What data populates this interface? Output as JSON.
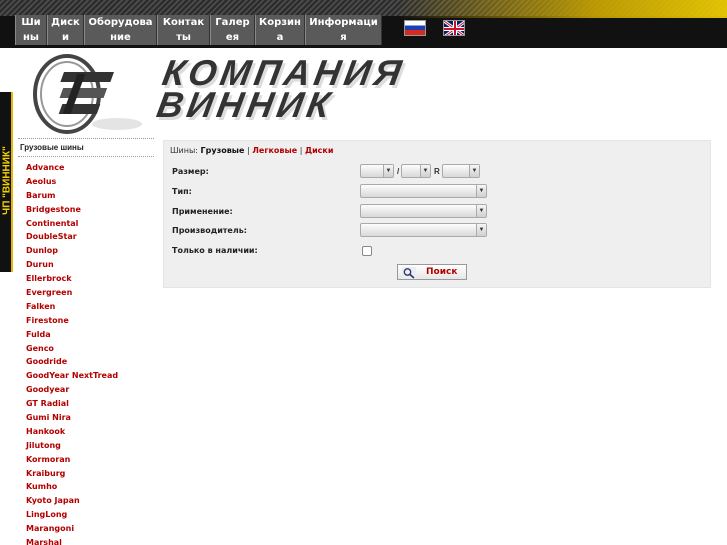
{
  "nav": {
    "items": [
      {
        "label": "Шины"
      },
      {
        "label": "Диски"
      },
      {
        "label": "Оборудование"
      },
      {
        "label": "Контакты"
      },
      {
        "label": "Галерея"
      },
      {
        "label": "Корзина"
      },
      {
        "label": "Информация"
      }
    ],
    "flags": [
      "flag-ru-icon",
      "flag-uk-icon"
    ]
  },
  "side_tab": {
    "label": "ЧП \"ВИННИК\""
  },
  "logo": {
    "line1": "КОМПАНИЯ",
    "line2": "ВИННИК"
  },
  "sidebar": {
    "title": "Грузовые шины",
    "brands": [
      "Advance",
      "Aeolus",
      "Barum",
      "Bridgestone",
      "Continental",
      "DoubleStar",
      "Dunlop",
      "Durun",
      "Ellerbrock",
      "Evergreen",
      "Falken",
      "Firestone",
      "Fulda",
      "Genco",
      "Goodride",
      "GoodYear NextTread",
      "Goodyear",
      "GT Radial",
      "Gumi Nira",
      "Hankook",
      "Jilutong",
      "Kormoran",
      "Kraiburg",
      "Kumho",
      "Kyoto Japan",
      "LingLong",
      "Marangoni",
      "Marshal"
    ]
  },
  "search": {
    "breadcrumb": {
      "prefix": "Шины:",
      "current": "Грузовые",
      "sep1": "|",
      "link1": "Легковые",
      "sep2": "|",
      "link2": "Диски"
    },
    "size_label": "Размер:",
    "size_sep": "/",
    "size_r": "R",
    "type_label": "Тип:",
    "usage_label": "Применение:",
    "maker_label": "Производитель:",
    "instock_label": "Только в наличии:",
    "button_label": "Поиск"
  },
  "colors": {
    "accent": "#b30000",
    "nav_bg": "#5a5a5a",
    "gold": "#f4d200"
  }
}
